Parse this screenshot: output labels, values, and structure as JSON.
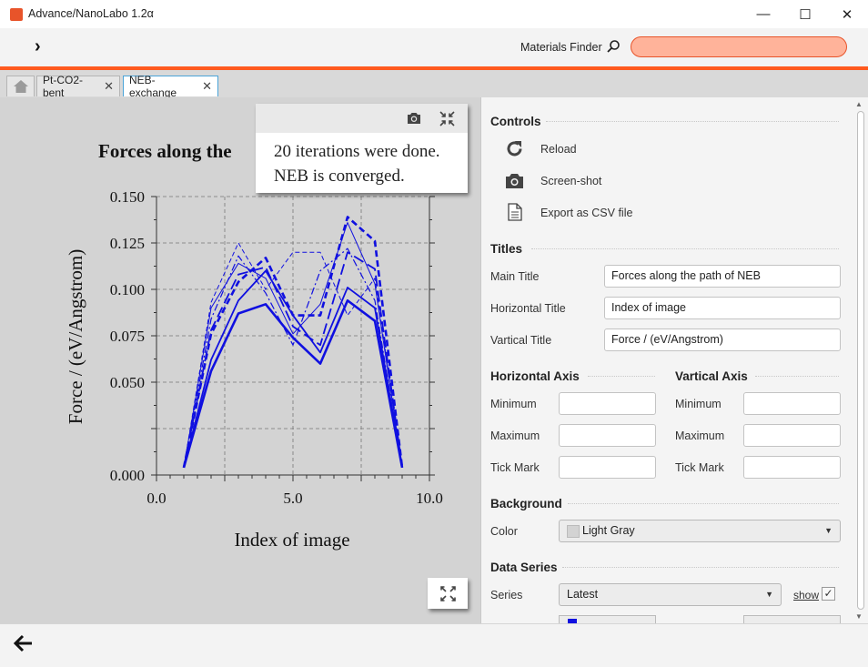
{
  "window": {
    "title": "Advance/NanoLabo 1.2α",
    "minimize": "—",
    "maximize": "☐",
    "close": "✕"
  },
  "toolbar": {
    "expand": "›",
    "finder_label": "Materials Finder",
    "finder_value": ""
  },
  "tabs": [
    {
      "label": "Pt-CO2-bent",
      "close": "✕"
    },
    {
      "label": "NEB-exchange",
      "close": "✕"
    }
  ],
  "popup": {
    "line1": "20 iterations were done.",
    "line2": "NEB is converged."
  },
  "controls": {
    "heading": "Controls",
    "reload": "Reload",
    "screenshot": "Screen-shot",
    "export": "Export as CSV file"
  },
  "titles": {
    "heading": "Titles",
    "main_label": "Main Title",
    "main_value": "Forces along the path of NEB",
    "horizontal_label": "Horizontal Title",
    "horizontal_value": "Index of image",
    "vertical_label": "Vartical Title",
    "vertical_value": "Force / (eV/Angstrom)"
  },
  "haxis": {
    "heading": "Horizontal Axis",
    "min_label": "Minimum",
    "max_label": "Maximum",
    "tick_label": "Tick Mark",
    "min_value": "",
    "max_value": "",
    "tick_value": ""
  },
  "vaxis": {
    "heading": "Vartical Axis",
    "min_label": "Minimum",
    "max_label": "Maximum",
    "tick_label": "Tick Mark",
    "min_value": "",
    "max_value": "",
    "tick_value": ""
  },
  "background": {
    "heading": "Background",
    "color_label": "Color",
    "color_value": "Light Gray"
  },
  "data_series": {
    "heading": "Data Series",
    "series_label": "Series",
    "series_value": "Latest",
    "show_label": "show",
    "show_checked": true
  },
  "colors": {
    "accent": "#ff5a1f",
    "series": "#1010e0",
    "plot_bg": "#d3d3d3"
  },
  "chart_data": {
    "type": "line",
    "title": "Forces along the",
    "xlabel": "Index of image",
    "ylabel": "Force / (eV/Angstrom)",
    "xlim": [
      0,
      10
    ],
    "ylim": [
      0,
      0.15
    ],
    "xticks": [
      "0.0",
      "5.0",
      "10.0"
    ],
    "yticks": [
      "0.150",
      "0.125",
      "0.100",
      "0.075",
      "0.050",
      "0.000"
    ],
    "grid": true,
    "series": [
      {
        "style": "solid-thick",
        "x": [
          1,
          2,
          3,
          4,
          5,
          6,
          7,
          8,
          9
        ],
        "y": [
          0.004,
          0.056,
          0.087,
          0.092,
          0.074,
          0.06,
          0.094,
          0.083,
          0.004
        ]
      },
      {
        "style": "solid",
        "x": [
          1,
          2,
          3,
          4,
          5,
          6,
          7,
          8,
          9
        ],
        "y": [
          0.004,
          0.062,
          0.094,
          0.11,
          0.086,
          0.066,
          0.101,
          0.09,
          0.004
        ]
      },
      {
        "style": "dashed-thick",
        "x": [
          1,
          2,
          3,
          4,
          5,
          6,
          7,
          8,
          9
        ],
        "y": [
          0.004,
          0.076,
          0.104,
          0.117,
          0.086,
          0.086,
          0.139,
          0.126,
          0.004
        ]
      },
      {
        "style": "long-dash",
        "x": [
          1,
          2,
          3,
          4,
          5,
          6,
          7,
          8,
          9
        ],
        "y": [
          0.004,
          0.078,
          0.108,
          0.112,
          0.08,
          0.07,
          0.12,
          0.111,
          0.004
        ]
      },
      {
        "style": "thin",
        "x": [
          1,
          2,
          3,
          4,
          5,
          6,
          7,
          8,
          9
        ],
        "y": [
          0.004,
          0.09,
          0.114,
          0.106,
          0.076,
          0.092,
          0.136,
          0.103,
          0.004
        ]
      },
      {
        "style": "thin-dashed",
        "x": [
          1,
          2,
          3,
          4,
          5,
          6,
          7,
          8,
          9
        ],
        "y": [
          0.004,
          0.093,
          0.125,
          0.1,
          0.12,
          0.12,
          0.086,
          0.106,
          0.004
        ]
      },
      {
        "style": "dash-dot",
        "x": [
          1,
          2,
          3,
          4,
          5,
          6,
          7,
          8,
          9
        ],
        "y": [
          0.004,
          0.084,
          0.118,
          0.098,
          0.07,
          0.11,
          0.122,
          0.094,
          0.004
        ]
      }
    ]
  }
}
